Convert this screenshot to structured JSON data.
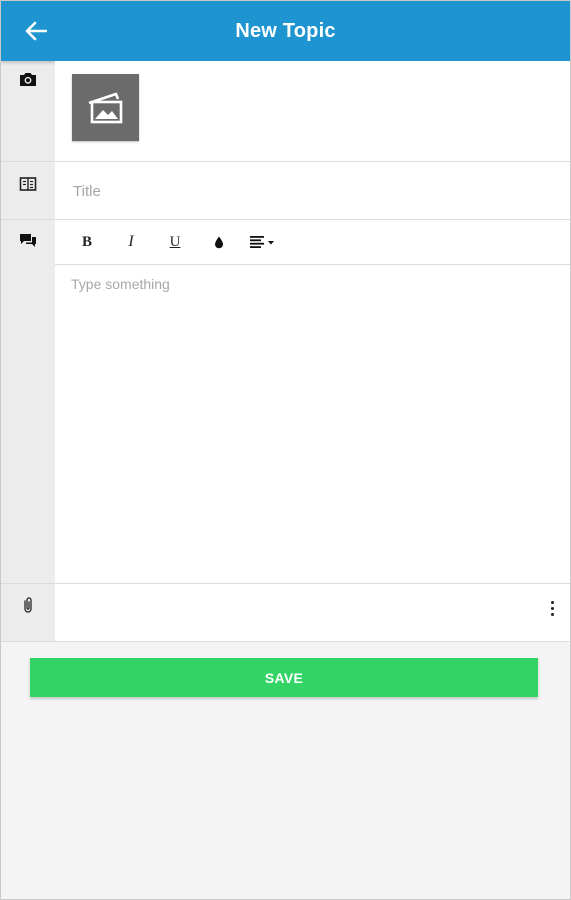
{
  "header": {
    "title": "New Topic",
    "back_icon": "arrow-left-icon",
    "color": "#1e94d0"
  },
  "photo": {
    "gutter_icon": "camera-icon",
    "thumb_icon": "image-placeholder-icon"
  },
  "title_field": {
    "placeholder": "Title",
    "value": "",
    "gutter_icon": "title-doc-icon"
  },
  "body_field": {
    "placeholder": "Type something",
    "value": "",
    "gutter_icon": "comment-icon"
  },
  "toolbar": {
    "bold": "B",
    "italic": "I",
    "underline": "U",
    "color_icon": "text-color-drop-icon",
    "align_icon": "align-dropdown-icon"
  },
  "attachments": {
    "gutter_icon": "paperclip-icon",
    "menu_icon": "more-vertical-icon"
  },
  "save": {
    "label": "SAVE",
    "color": "#33d466"
  }
}
